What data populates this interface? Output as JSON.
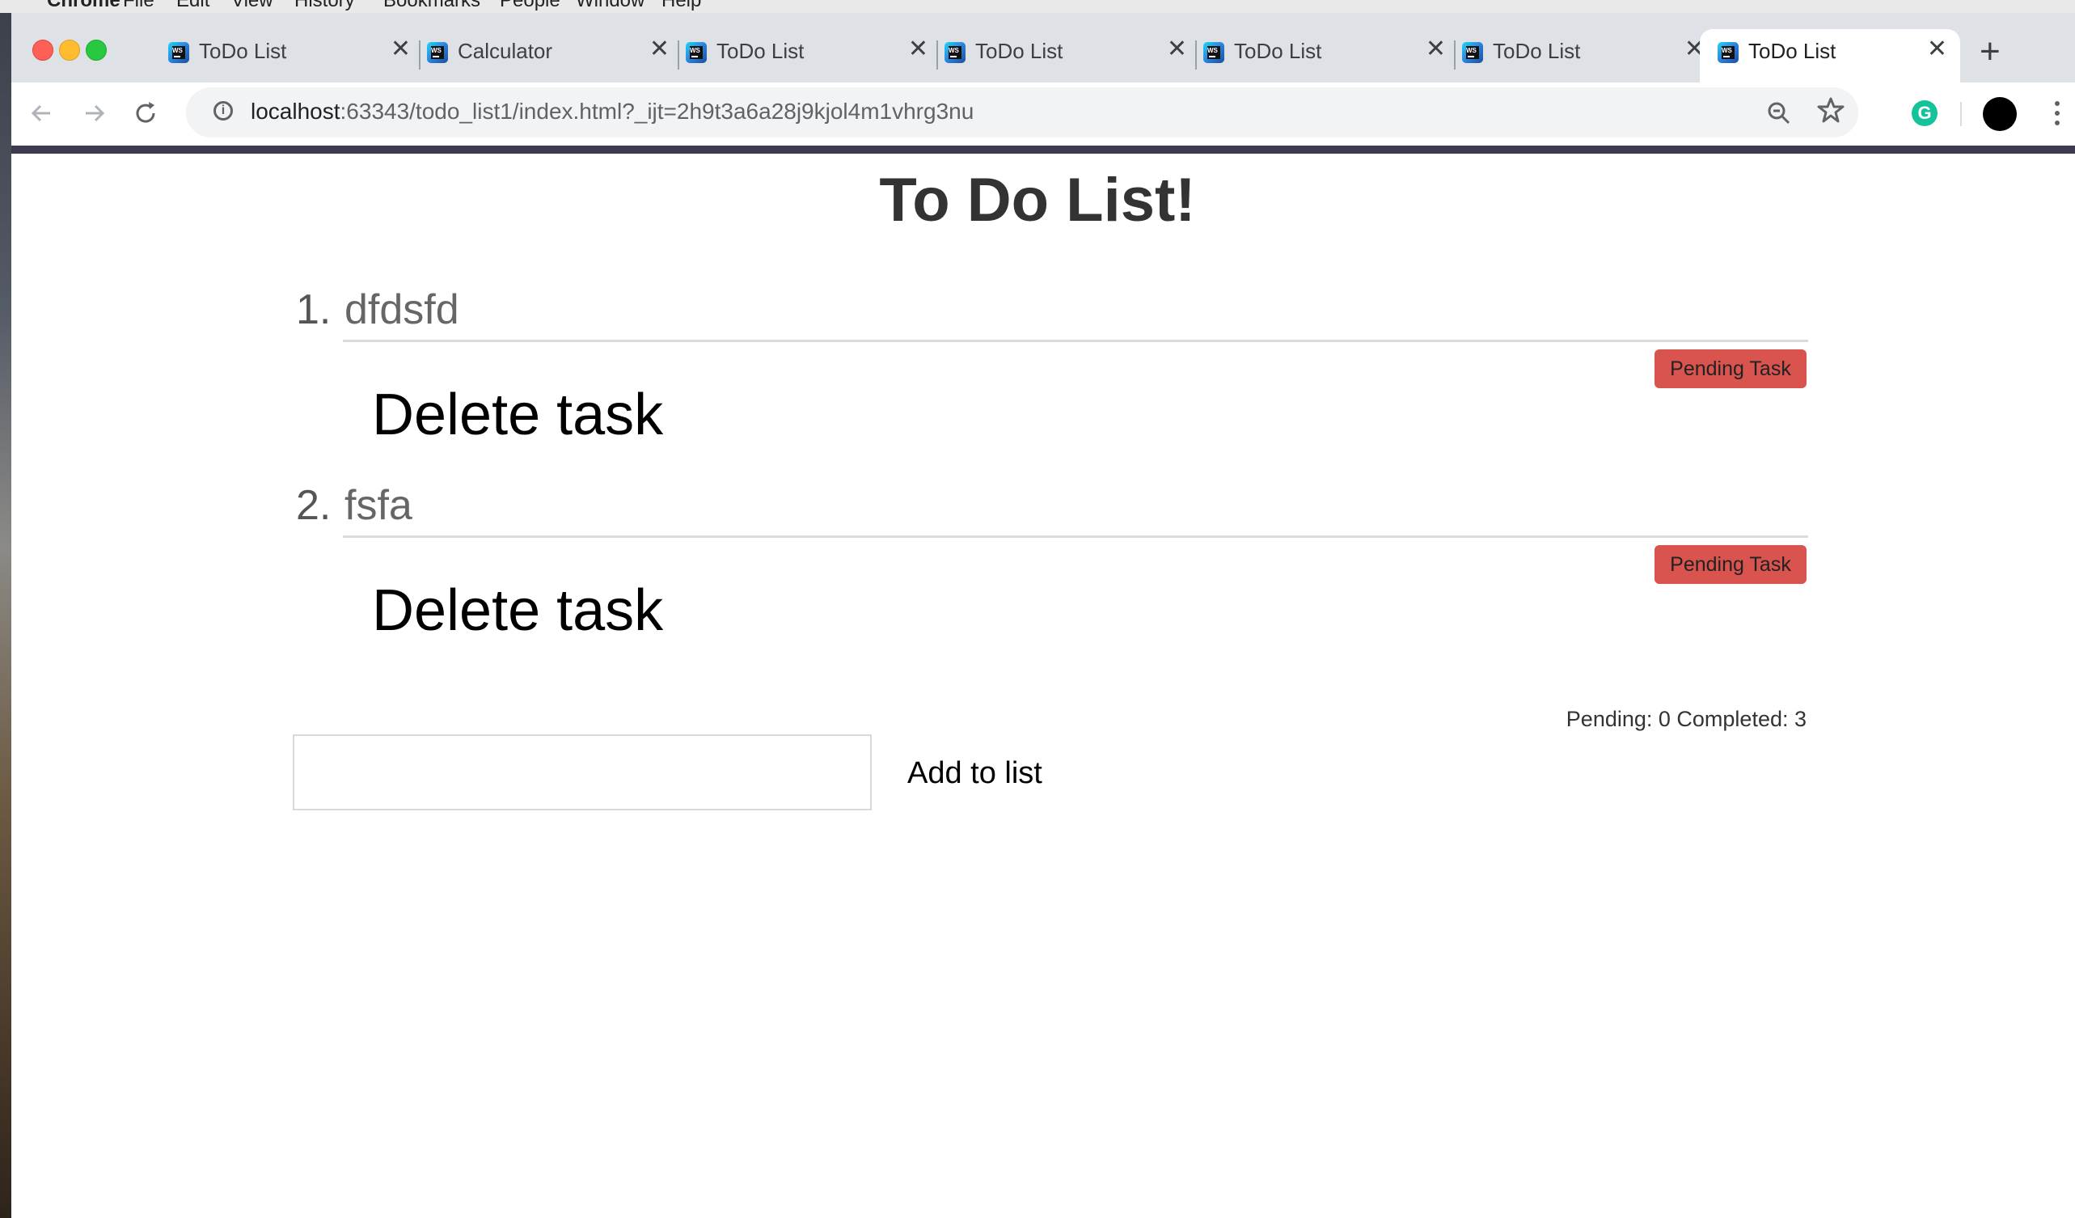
{
  "os_menubar": {
    "items": [
      "Chrome",
      "File",
      "Edit",
      "View",
      "History",
      "Bookmarks",
      "People",
      "Window",
      "Help"
    ]
  },
  "browser": {
    "tabs": [
      {
        "title": "ToDo List",
        "active": false
      },
      {
        "title": "Calculator",
        "active": false
      },
      {
        "title": "ToDo List",
        "active": false
      },
      {
        "title": "ToDo List",
        "active": false
      },
      {
        "title": "ToDo List",
        "active": false
      },
      {
        "title": "ToDo List",
        "active": false
      },
      {
        "title": "ToDo List",
        "active": true
      }
    ],
    "favicon_text": "WS",
    "close_glyph": "✕",
    "new_tab_glyph": "+",
    "address": {
      "host": "localhost",
      "path": ":63343/todo_list1/index.html?_ijt=2h9t3a6a28j9kjol4m1vhrg3nu"
    },
    "grammarly_letter": "G"
  },
  "page": {
    "title": "To Do List!",
    "todos": [
      {
        "number": "1.",
        "text": "dfdsfd",
        "status": "Pending Task",
        "delete_label": "Delete task"
      },
      {
        "number": "2.",
        "text": "fsfa",
        "status": "Pending Task",
        "delete_label": "Delete task"
      }
    ],
    "counts": "Pending: 0 Completed: 3",
    "input": {
      "value": "",
      "placeholder": ""
    },
    "add_label": "Add to list"
  },
  "colors": {
    "badge": "#d9534f",
    "page_top_bar": "#3e3a52",
    "tabstrip": "#dee1e6"
  }
}
